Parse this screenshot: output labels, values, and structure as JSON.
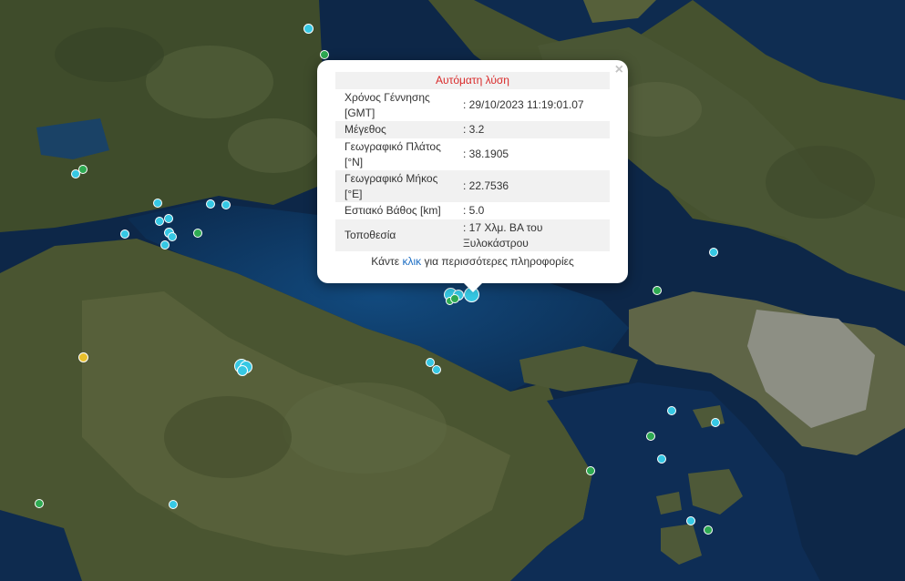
{
  "popup": {
    "title": "Αυτόματη λύση",
    "close_glyph": "×",
    "rows": [
      {
        "label": "Χρόνος Γέννησης [GMT]",
        "value": ": 29/10/2023 11:19:01.07"
      },
      {
        "label": "Μέγεθος",
        "value": ": 3.2"
      },
      {
        "label": "Γεωγραφικό Πλάτος [°N]",
        "value": ": 38.1905"
      },
      {
        "label": "Γεωγραφικό Μήκος [°E]",
        "value": ": 22.7536"
      },
      {
        "label": "Εστιακό Βάθος [km]",
        "value": ": 5.0"
      },
      {
        "label": "Τοποθεσία",
        "value": ": 17 Χλμ. ΒΑ του Ξυλοκάστρου"
      }
    ],
    "more_prefix": "Κάντε ",
    "more_link": "κλικ",
    "more_suffix": " για περισσότερες πληροφορίες"
  },
  "colors": {
    "marker_cyan": "#36c8e4",
    "marker_green": "#2eaa52",
    "marker_yellow": "#e7c02c",
    "popup_title": "#d92a2a",
    "link": "#1e6fc4",
    "sea": "#0e2a4c",
    "land": "#4c5a36"
  },
  "markers": [
    {
      "color": "cyan",
      "icon": "earthquake-marker"
    },
    {
      "color": "green",
      "icon": "earthquake-marker"
    },
    {
      "color": "yellow",
      "icon": "earthquake-marker"
    }
  ]
}
